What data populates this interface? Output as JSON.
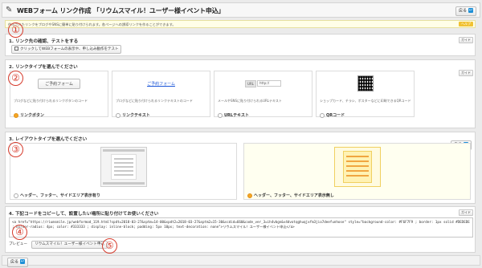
{
  "header": {
    "title": "WEBフォーム リンク作成 「リウムスマイル！ユーザー様イベント申込」",
    "back_label": "戻る"
  },
  "notice": {
    "text": "作成されたリンクをブログやSNSに簡単に貼り付けられます。各ページへの誘導リンクを作ることができます。",
    "tag": "ヘルプ"
  },
  "guide_label": "ガイド",
  "section1": {
    "title": "1. リンク先の確認、テストをする",
    "button_label": "クリックしてWEBフォームの表示や、申し込み動作をテスト"
  },
  "section2": {
    "title": "2. リンクタイプを選んでください",
    "cards": [
      {
        "sample": "ご予約フォーム",
        "desc": "ブログなどに貼り付けられるリンクボタンのコード",
        "label": "リンクボタン",
        "selected": true
      },
      {
        "sample": "ご予約フォーム",
        "desc": "ブログなどに貼り付けられるリンクテキストのコード",
        "label": "リンクテキスト",
        "selected": false
      },
      {
        "sample_tag": "URL",
        "sample_field": "http://",
        "desc": "メールやSNSに貼り付けられるURLテキスト",
        "label": "URLテキスト",
        "selected": false
      },
      {
        "desc": "ショップカード、チラシ、ポスターなどに印刷できるQRコード",
        "label": "QRコード",
        "selected": false
      }
    ]
  },
  "section3": {
    "title": "3. レイアウトタイプを選んでください",
    "options": [
      {
        "label": "ヘッダー、フッター、サイドエリア表示有り",
        "selected": false
      },
      {
        "label": "ヘッダー、フッター、サイドエリア表示無し",
        "selected": true
      }
    ]
  },
  "section4": {
    "title": "4. 下記コードをコピーして、設置したい場所に貼り付けてお使いください",
    "code": "<a href=\"https://riumsmile.jp/webformod_119.html?spdt=2018-03-27&sptm=14-00&spdt2=2018-03-27&sptm2=15-30&scdid=660&code_ver_3=ih4vbgn&v4dvotqghuqjxfm3jio7deefunhose\" style=\"background-color: #F6F7F9 ; border: 1px solid #DEDEDE ; border-radius: 4px; color: #333333 ; display: inline-block; padding: 5px 10px; text-decoration: none\">リウムスマイル！ユーザー様イベント申込</a>",
    "preview_label": "プレビュー",
    "preview_button_label": "リウムスマイル！ユーザー様イベント申込"
  },
  "footer": {
    "back_label": "戻る"
  },
  "markers": [
    "①",
    "②",
    "③",
    "④",
    "⑤"
  ],
  "colors": {
    "accent": "#f5a623",
    "link": "#1a55d8",
    "marker": "#d63b2c"
  }
}
